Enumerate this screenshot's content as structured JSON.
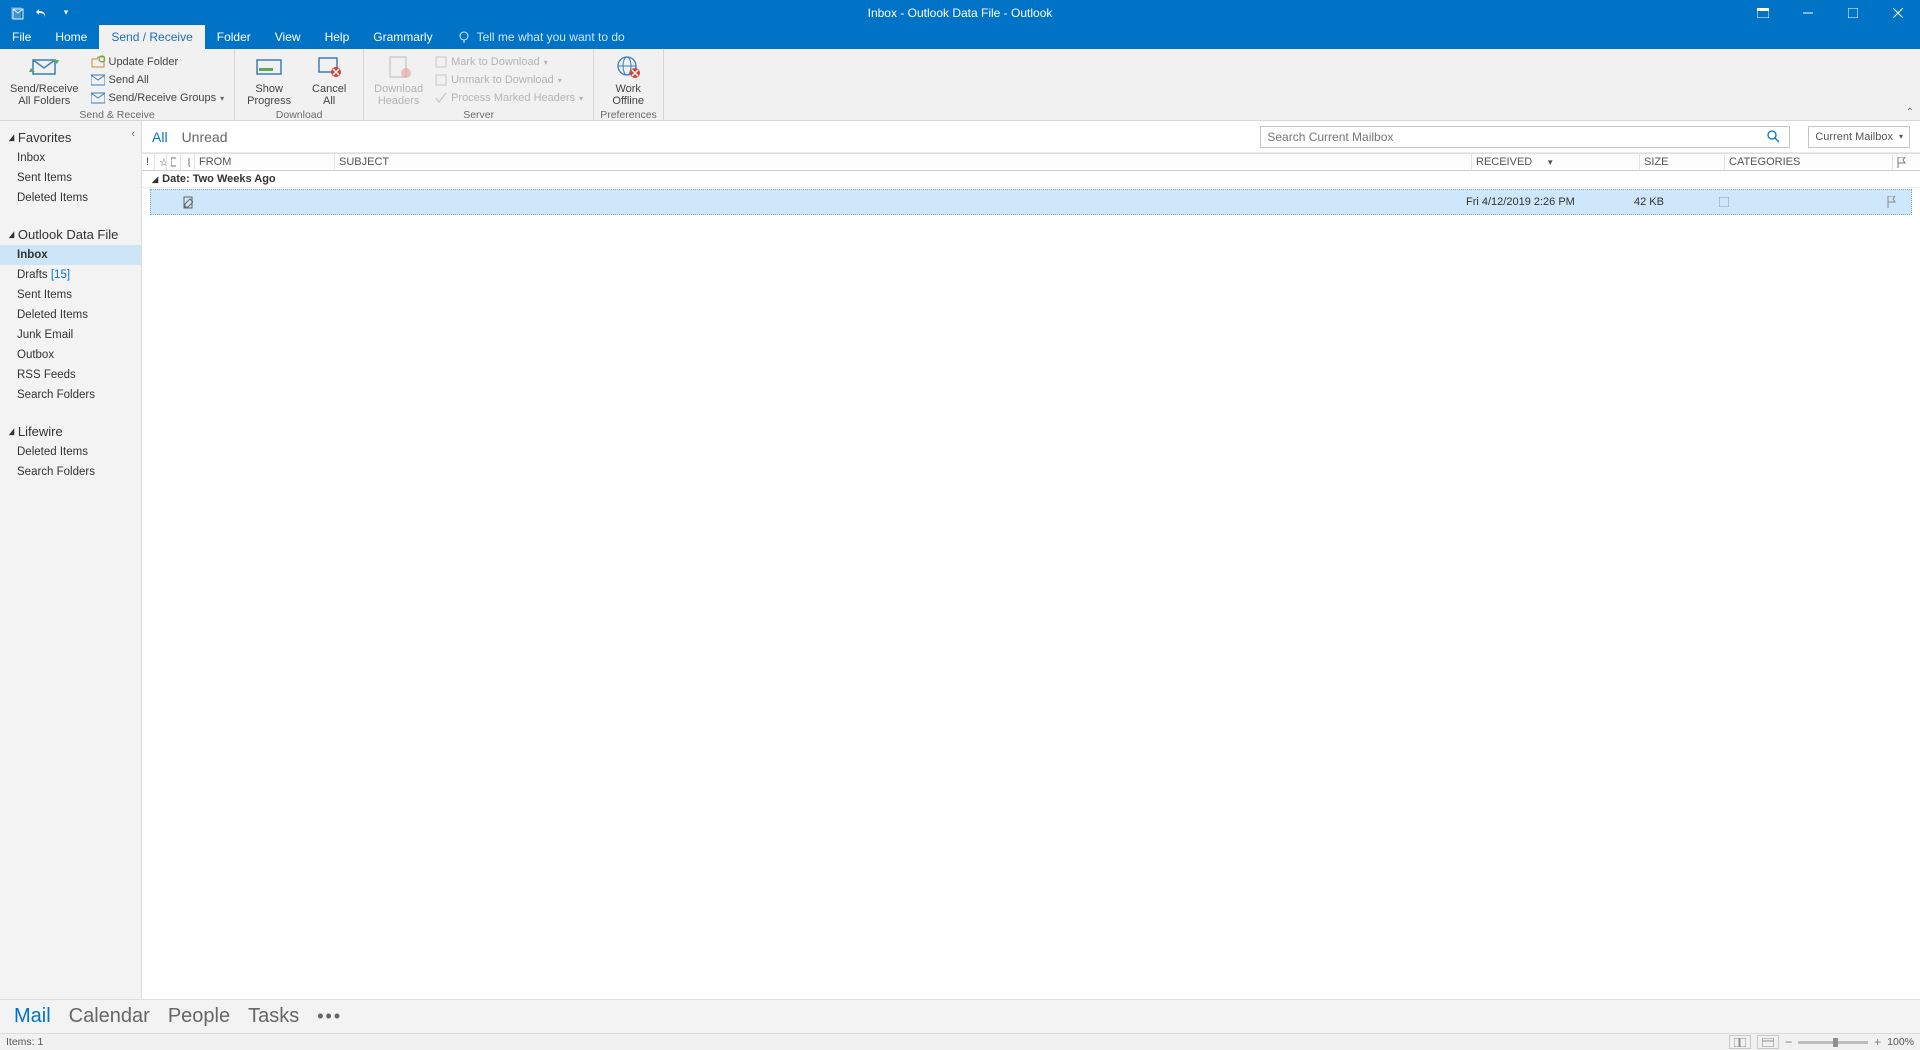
{
  "window": {
    "title": "Inbox - Outlook Data File  -  Outlook"
  },
  "tabs": {
    "file": "File",
    "home": "Home",
    "sendreceive": "Send / Receive",
    "folder": "Folder",
    "view": "View",
    "help": "Help",
    "grammarly": "Grammarly",
    "tellme": "Tell me what you want to do"
  },
  "ribbon": {
    "group_send_receive": "Send & Receive",
    "group_download": "Download",
    "group_server": "Server",
    "group_preferences": "Preferences",
    "send_receive_all": "Send/Receive\nAll Folders",
    "update_folder": "Update Folder",
    "send_all": "Send All",
    "sr_groups": "Send/Receive Groups",
    "show_progress": "Show\nProgress",
    "cancel_all": "Cancel\nAll",
    "download_headers": "Download\nHeaders",
    "mark_to_download": "Mark to Download",
    "unmark_to_download": "Unmark to Download",
    "process_marked": "Process Marked Headers",
    "work_offline": "Work\nOffline"
  },
  "folders": {
    "favorites": "Favorites",
    "fav_items": [
      "Inbox",
      "Sent Items",
      "Deleted Items"
    ],
    "data_file": "Outlook Data File",
    "df_items": [
      {
        "label": "Inbox",
        "selected": true
      },
      {
        "label": "Drafts",
        "count": "[15]"
      },
      {
        "label": "Sent Items"
      },
      {
        "label": "Deleted Items"
      },
      {
        "label": "Junk Email"
      },
      {
        "label": "Outbox"
      },
      {
        "label": "RSS Feeds"
      },
      {
        "label": "Search Folders"
      }
    ],
    "lifewire": "Lifewire",
    "lw_items": [
      "Deleted Items",
      "Search Folders"
    ]
  },
  "list": {
    "filter_all": "All",
    "filter_unread": "Unread",
    "search_placeholder": "Search Current Mailbox",
    "scope": "Current Mailbox",
    "columns": {
      "from": "FROM",
      "subject": "SUBJECT",
      "received": "RECEIVED",
      "size": "SIZE",
      "categories": "CATEGORIES"
    },
    "group_label": "Date: Two Weeks Ago",
    "rows": [
      {
        "from": "",
        "subject": "",
        "received": "Fri 4/12/2019 2:26 PM",
        "size": "42 KB",
        "categories": ""
      }
    ]
  },
  "nav": {
    "mail": "Mail",
    "calendar": "Calendar",
    "people": "People",
    "tasks": "Tasks"
  },
  "status": {
    "items": "Items: 1",
    "zoom": "100%"
  }
}
